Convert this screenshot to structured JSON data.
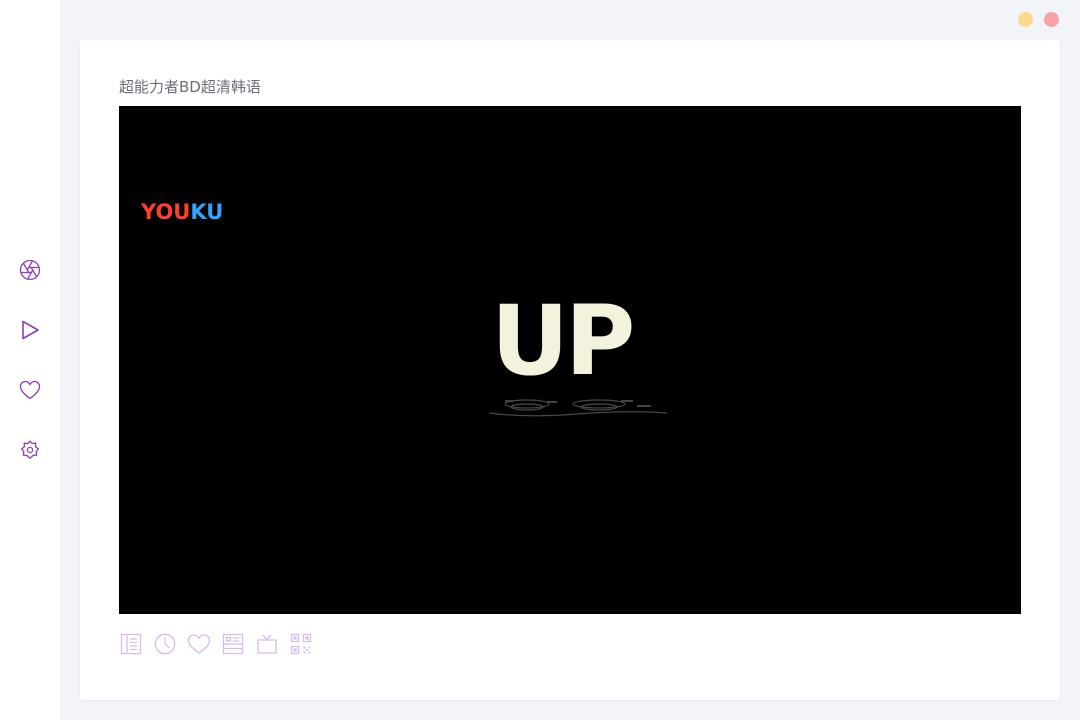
{
  "window": {
    "minimize_color": "#fcd98f",
    "close_color": "#f7a2a6"
  },
  "sidebar": {
    "accent_color": "#8a3fb5",
    "items": [
      {
        "icon": "aperture-icon",
        "label": "camera"
      },
      {
        "icon": "play-icon",
        "label": "play"
      },
      {
        "icon": "heart-icon",
        "label": "favorites"
      },
      {
        "icon": "settings-icon",
        "label": "settings"
      }
    ]
  },
  "main": {
    "video_title": "超能力者BD超清韩语",
    "player": {
      "watermark": {
        "part1": "YOU",
        "part2": "KU",
        "part1_color": "#ff3f2e",
        "part2_color": "#2ea6ff"
      },
      "frame_text": "UP"
    },
    "toolbar": {
      "icon_color": "#d7bce6",
      "items": [
        {
          "icon": "list-icon"
        },
        {
          "icon": "clock-icon"
        },
        {
          "icon": "heart-icon"
        },
        {
          "icon": "id-card-icon"
        },
        {
          "icon": "tv-icon"
        },
        {
          "icon": "qrcode-icon"
        }
      ]
    }
  }
}
